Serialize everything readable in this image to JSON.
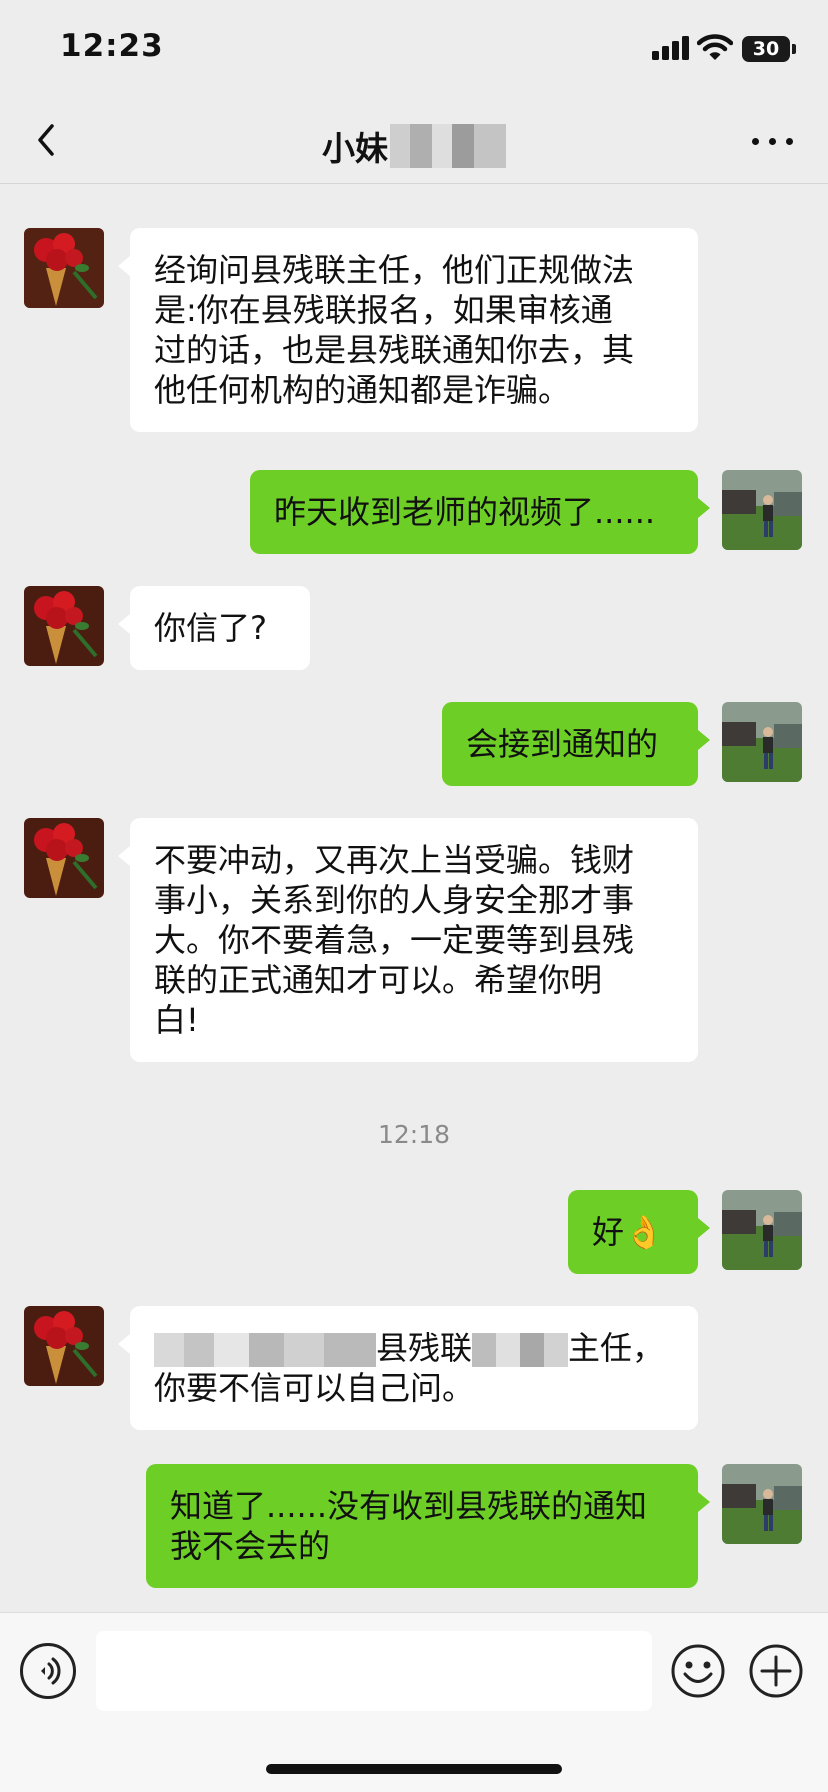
{
  "status_bar": {
    "time": "12:23",
    "battery": "30"
  },
  "header": {
    "title": "小妹",
    "back_icon": "chevron-left-icon",
    "more_icon": "more-horizontal-icon"
  },
  "messages": [
    {
      "side": "in",
      "text": "经询问县残联主任，他们正规做法\n是:你在县残联报名，如果审核通\n过的话，也是县残联通知你去，其\n他任何机构的通知都是诈骗。"
    },
    {
      "side": "out",
      "text": "昨天收到老师的视频了......"
    },
    {
      "side": "in",
      "text": "你信了?"
    },
    {
      "side": "out",
      "text": "会接到通知的"
    },
    {
      "side": "in",
      "text": "不要冲动，又再次上当受骗。钱财\n事小，关系到你的人身安全那才事\n大。你不要着急，一定要等到县残\n联的正式通知才可以。希望你明\n白!"
    },
    {
      "side": "out",
      "text": "好👌"
    },
    {
      "side": "in",
      "text_a": "县残联",
      "text_b": "主任，",
      "text_c": "你要不信可以自己问。"
    },
    {
      "side": "out",
      "text": "知道了......没有收到县残联的通知\n我不会去的"
    }
  ],
  "timestamp": "12:18",
  "input": {
    "placeholder": "",
    "voice_icon": "voice-icon",
    "emoji_icon": "emoji-icon",
    "plus_icon": "plus-icon"
  },
  "colors": {
    "background": "#ededed",
    "outgoing_bubble": "#6dcf26",
    "incoming_bubble": "#ffffff"
  }
}
